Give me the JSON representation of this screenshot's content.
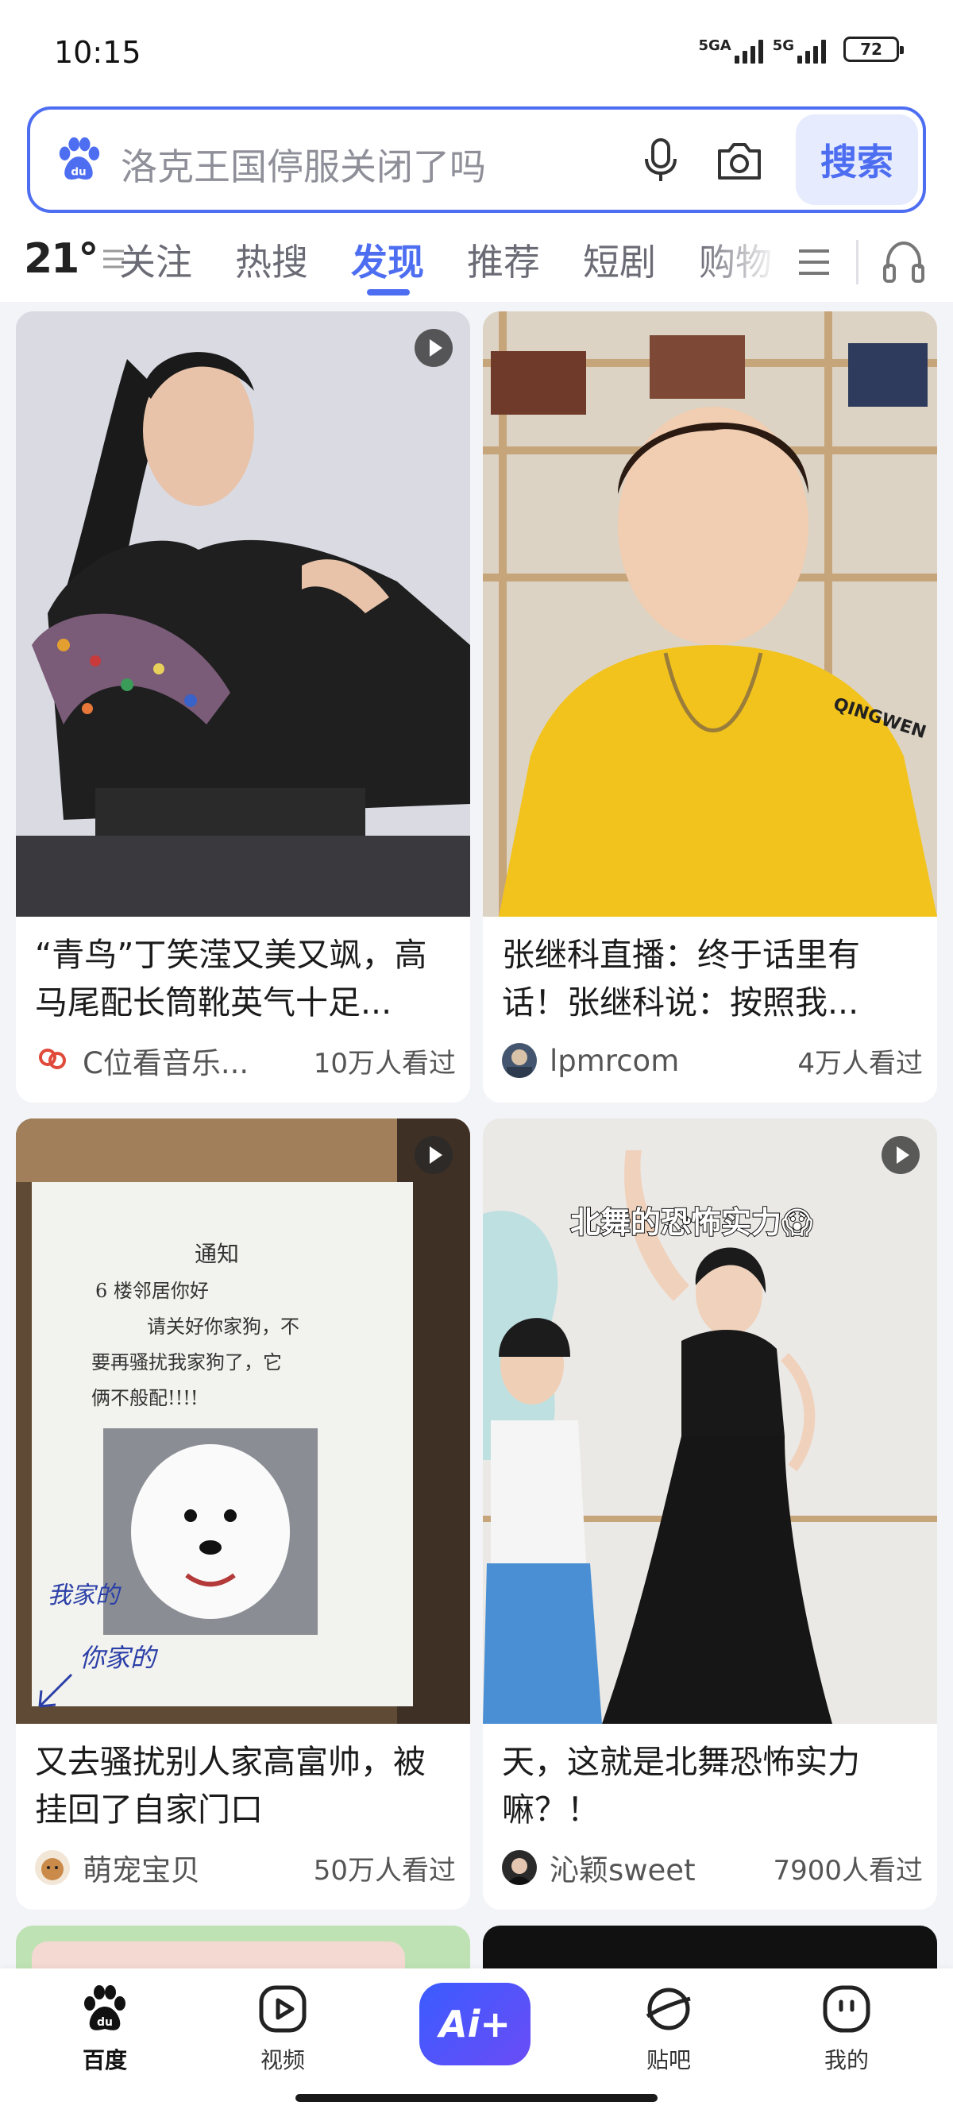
{
  "status_bar": {
    "time": "10:15",
    "network1": "5GA",
    "network2": "5G",
    "battery": "72"
  },
  "search": {
    "placeholder": "洛克王国停服关闭了吗",
    "button": "搜索",
    "accent": "#4e6ef2"
  },
  "weather": {
    "temp": "21°"
  },
  "tabs": [
    {
      "label": "关注"
    },
    {
      "label": "热搜"
    },
    {
      "label": "发现"
    },
    {
      "label": "推荐"
    },
    {
      "label": "短剧"
    },
    {
      "label": "购物"
    }
  ],
  "active_tab": "发现",
  "feed": [
    {
      "title": "“青鸟”丁笑滢又美又飒，高马尾配长筒靴英气十足...",
      "author": "C位看音乐...",
      "views": "10万人看过",
      "has_video": true
    },
    {
      "title": "张继科直播：终于话里有话！张继科说：按照我...",
      "author": "lpmrcom",
      "views": "4万人看过",
      "has_video": false,
      "shirt_text": "QINGWEN"
    },
    {
      "title": "又去骚扰别人家高富帅，被挂回了自家门口",
      "author": "萌宠宝贝",
      "views": "50万人看过",
      "has_video": true,
      "notice_title": "通知",
      "notice_line1": "6 楼邻居你好",
      "notice_line2": "请关好你家狗，不",
      "notice_line3": "要再骚扰我家狗了，它",
      "notice_line4": "俩不般配!!!!",
      "note_mine": "我家的",
      "note_yours": "你家的"
    },
    {
      "title": "天，这就是北舞恐怖实力嘛？！",
      "author": "沁颖sweet",
      "views": "7900人看过",
      "has_video": true,
      "overlay": "北舞的恐怖实力😱"
    }
  ],
  "bottom_nav": [
    {
      "label": "百度",
      "icon": "baidu-paw-icon"
    },
    {
      "label": "视频",
      "icon": "video-play-icon"
    },
    {
      "label": "Ai+",
      "icon": "ai-icon"
    },
    {
      "label": "贴吧",
      "icon": "tieba-icon"
    },
    {
      "label": "我的",
      "icon": "profile-icon"
    }
  ]
}
